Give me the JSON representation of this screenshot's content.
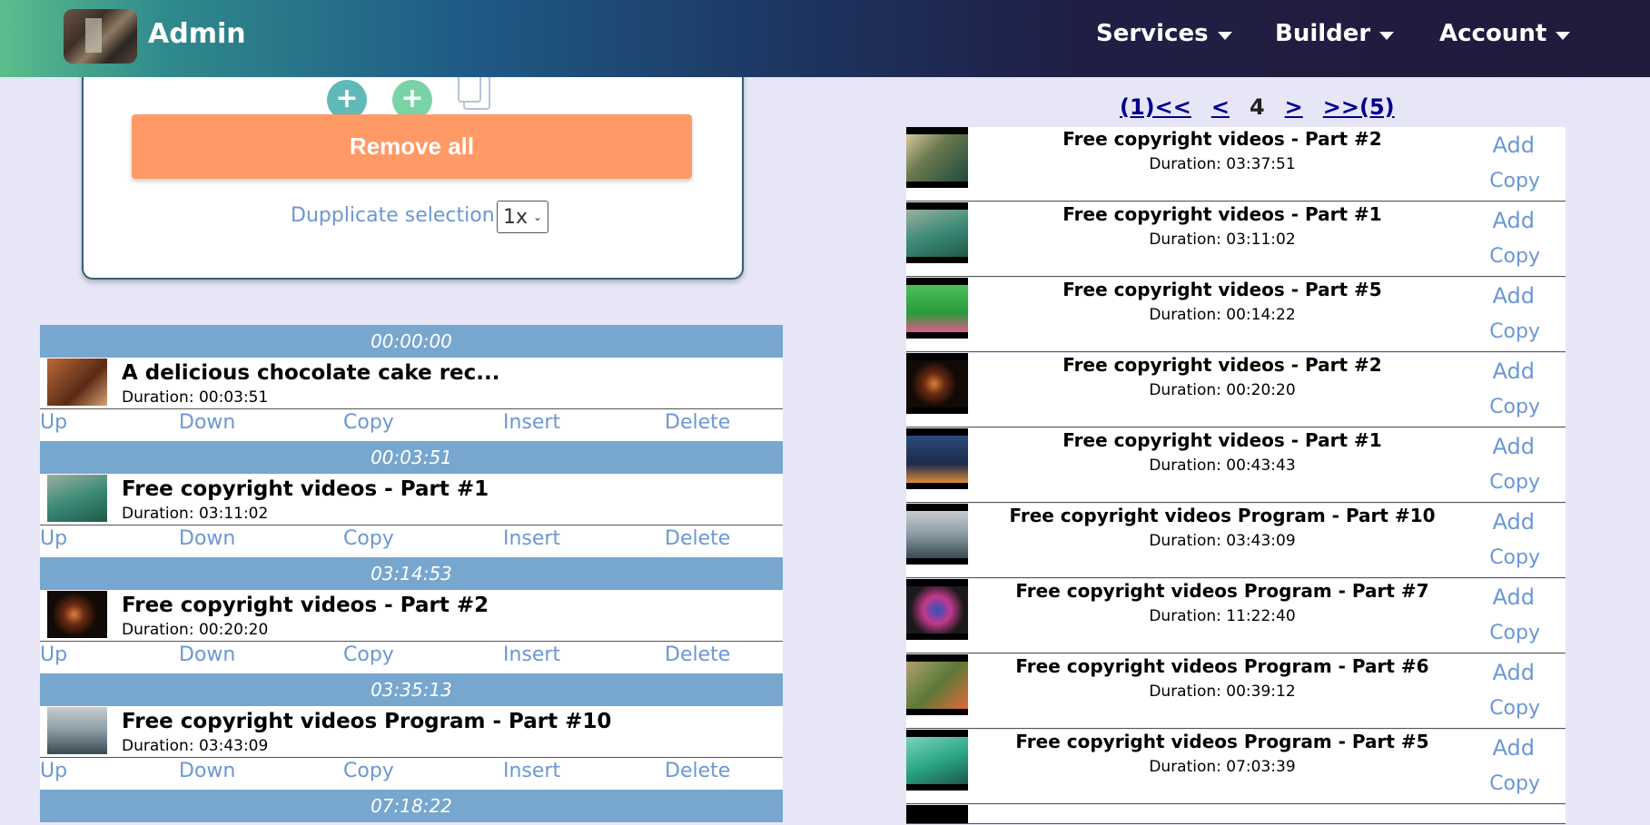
{
  "navbar": {
    "brand": "Admin",
    "menu": [
      {
        "label": "Services"
      },
      {
        "label": "Builder"
      },
      {
        "label": "Account"
      }
    ]
  },
  "card": {
    "plus": "+",
    "remove_all_label": "Remove all",
    "duplicate_label": "Dupplicate selection",
    "duplicate_value": "1x"
  },
  "playlist": {
    "action_labels": {
      "up": "Up",
      "down": "Down",
      "copy": "Copy",
      "insert": "Insert",
      "delete": "Delete"
    },
    "items": [
      {
        "start": "00:00:00",
        "title": "A delicious chocolate cake rec...",
        "duration": "Duration: 00:03:51",
        "thumb": "#8a4a2a"
      },
      {
        "start": "00:03:51",
        "title": "Free copyright videos - Part #1",
        "duration": "Duration: 03:11:02",
        "thumb": "#3e8a78"
      },
      {
        "start": "03:14:53",
        "title": "Free copyright videos - Part #2",
        "duration": "Duration: 00:20:20",
        "thumb": "#2a1a12"
      },
      {
        "start": "03:35:13",
        "title": "Free copyright videos Program - Part #10",
        "duration": "Duration: 03:43:09",
        "thumb": "#7e8c96"
      },
      {
        "start": "07:18:22"
      }
    ]
  },
  "pager": {
    "first": "(1)<<",
    "prev": "<",
    "current": "4",
    "next": ">",
    "last": ">>(5)"
  },
  "library": {
    "add_label": "Add",
    "copy_label": "Copy",
    "items": [
      {
        "title": "Free copyright videos - Part #2",
        "duration": "Duration: 03:37:51",
        "thumb": "#1d4a3a"
      },
      {
        "title": "Free copyright videos - Part #1",
        "duration": "Duration: 03:11:02",
        "thumb": "#3e8a78"
      },
      {
        "title": "Free copyright videos - Part #5",
        "duration": "Duration: 00:14:22",
        "thumb": "#3db04a"
      },
      {
        "title": "Free copyright videos - Part #2",
        "duration": "Duration: 00:20:20",
        "thumb": "#2a1a12"
      },
      {
        "title": "Free copyright videos - Part #1",
        "duration": "Duration: 00:43:43",
        "thumb": "#1c2c4a"
      },
      {
        "title": "Free copyright videos Program - Part #10",
        "duration": "Duration: 03:43:09",
        "thumb": "#7e8c96"
      },
      {
        "title": "Free copyright videos Program - Part #7",
        "duration": "Duration: 11:22:40",
        "thumb": "#3050c0"
      },
      {
        "title": "Free copyright videos Program - Part #6",
        "duration": "Duration: 00:39:12",
        "thumb": "#5a7a38"
      },
      {
        "title": "Free copyright videos Program - Part #5",
        "duration": "Duration: 07:03:39",
        "thumb": "#2ca888"
      }
    ]
  }
}
